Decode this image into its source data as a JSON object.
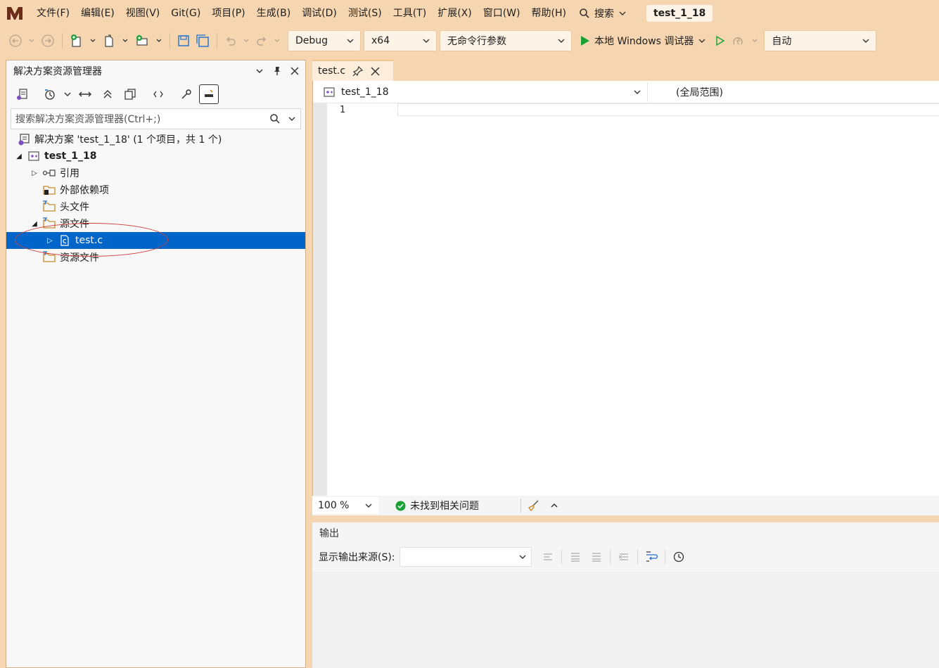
{
  "menu": {
    "items": [
      "文件(F)",
      "编辑(E)",
      "视图(V)",
      "Git(G)",
      "项目(P)",
      "生成(B)",
      "调试(D)",
      "测试(S)",
      "工具(T)",
      "扩展(X)",
      "窗口(W)",
      "帮助(H)"
    ],
    "search_label": "搜索",
    "project_title": "test_1_18"
  },
  "toolbar": {
    "configuration": "Debug",
    "platform": "x64",
    "command_args": "无命令行参数",
    "debugger_label": "本地 Windows 调试器",
    "auto_label": "自动"
  },
  "solution_explorer": {
    "title": "解决方案资源管理器",
    "search_placeholder": "搜索解决方案资源管理器(Ctrl+;)",
    "tree": {
      "solution": "解决方案 'test_1_18' (1 个项目，共 1 个)",
      "project": "test_1_18",
      "references": "引用",
      "external_deps": "外部依赖项",
      "header_files": "头文件",
      "source_files": "源文件",
      "test_file": "test.c",
      "resource_files": "资源文件"
    }
  },
  "editor": {
    "tab_label": "test.c",
    "nav_project": "test_1_18",
    "nav_scope": "(全局范围)",
    "line_number": "1"
  },
  "statusbar": {
    "zoom": "100 %",
    "issues": "未找到相关问题"
  },
  "output": {
    "title": "输出",
    "source_label": "显示输出来源(S):"
  },
  "colors": {
    "chrome": "#f5d6b0",
    "selection": "#0064c8",
    "run_green": "#17a233",
    "annotation_ellipse": "#d0413e"
  }
}
